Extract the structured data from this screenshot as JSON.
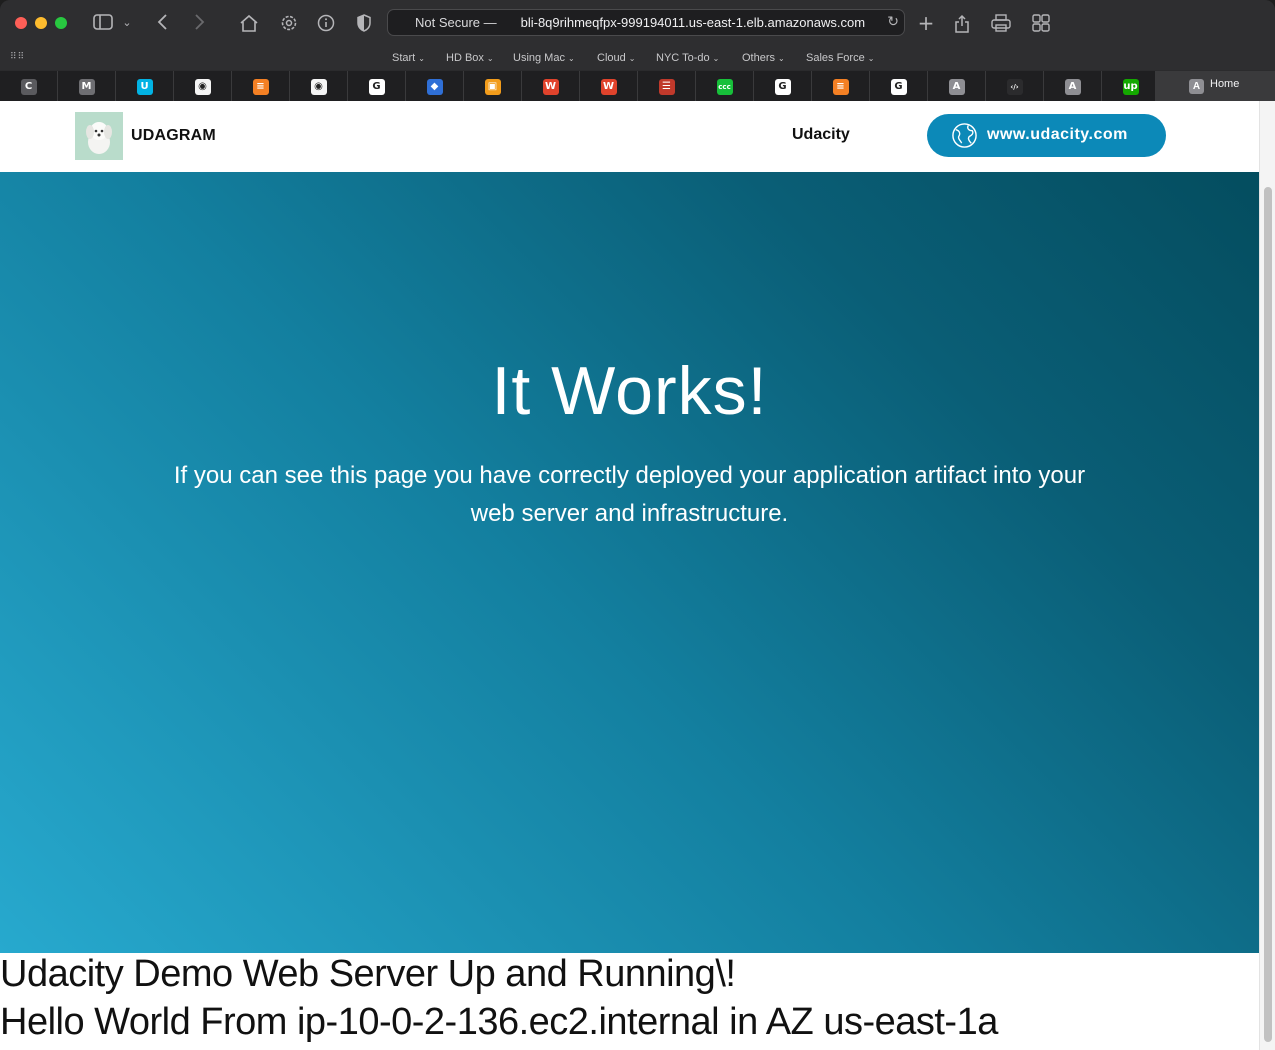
{
  "browser": {
    "url_prefix": "Not Secure —",
    "url_host": " bli-8q9rihmeqfpx-999194011.us-east-1.elb.amazonaws.com",
    "favorites": [
      "Start",
      "HD Box",
      "Using Mac",
      "Cloud",
      "NYC To-do",
      "Others",
      "Sales Force"
    ],
    "tabs": [
      {
        "icon": "c-icon",
        "glyph": "C",
        "color": "#5a5a5e"
      },
      {
        "icon": "m-icon",
        "glyph": "M",
        "color": "#6e6e72"
      },
      {
        "icon": "udacity-icon",
        "glyph": "U",
        "color": "#02b3e4"
      },
      {
        "icon": "github-icon",
        "glyph": "◉",
        "color": "#f5f5f5"
      },
      {
        "icon": "stackoverflow-icon",
        "glyph": "≡",
        "color": "#f48024"
      },
      {
        "icon": "github-icon",
        "glyph": "◉",
        "color": "#f5f5f5"
      },
      {
        "icon": "google-icon",
        "glyph": "G",
        "color": "#ffffff"
      },
      {
        "icon": "shield-blue-icon",
        "glyph": "◆",
        "color": "#2f6fd6"
      },
      {
        "icon": "aws-box-icon",
        "glyph": "▣",
        "color": "#f29c1b"
      },
      {
        "icon": "w-icon",
        "glyph": "W",
        "color": "#e0432c"
      },
      {
        "icon": "w-icon",
        "glyph": "W",
        "color": "#e0432c"
      },
      {
        "icon": "bars-icon",
        "glyph": "☰",
        "color": "#c0392b"
      },
      {
        "icon": "ccc-icon",
        "glyph": "ccc",
        "color": "#17c03a"
      },
      {
        "icon": "google-icon",
        "glyph": "G",
        "color": "#ffffff"
      },
      {
        "icon": "stackoverflow-icon",
        "glyph": "≡",
        "color": "#f48024"
      },
      {
        "icon": "google-icon",
        "glyph": "G",
        "color": "#ffffff"
      },
      {
        "icon": "a-icon",
        "glyph": "A",
        "color": "#8e8e93"
      },
      {
        "icon": "code-icon",
        "glyph": "‹/›",
        "color": "#2b2b2d"
      },
      {
        "icon": "a-icon",
        "glyph": "A",
        "color": "#8e8e93"
      },
      {
        "icon": "upwork-icon",
        "glyph": "up",
        "color": "#14a800"
      }
    ],
    "active_tab": {
      "icon_glyph": "A",
      "label": "Home"
    }
  },
  "nav": {
    "brand": "UDAGRAM",
    "link": "Udacity",
    "button_label": "www.udacity.com"
  },
  "hero": {
    "title": "It Works!",
    "text": "If you can see this page you have correctly deployed your application artifact into your web server and infrastructure."
  },
  "footer": {
    "line1": "Udacity Demo Web Server Up and Running\\!",
    "line2": "Hello World From ip-10-0-2-136.ec2.internal in AZ us-east-1a"
  },
  "colors": {
    "accent": "#0c89b8",
    "hero_start": "#27a9ce",
    "hero_end": "#044d5f"
  }
}
